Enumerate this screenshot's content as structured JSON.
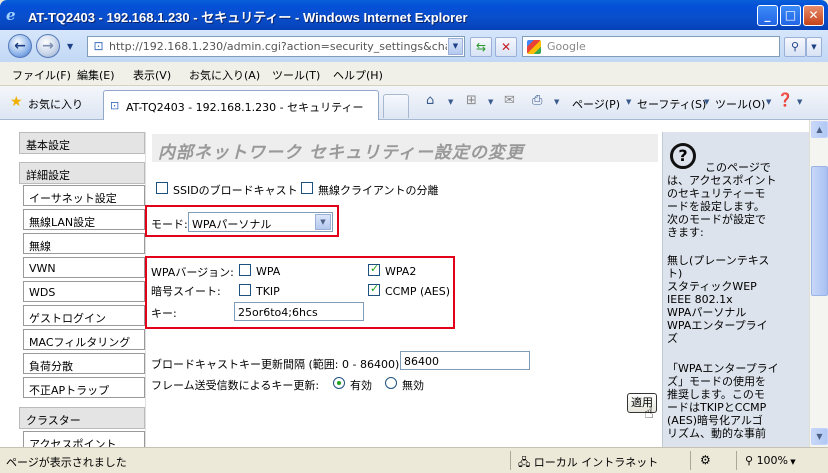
{
  "window": {
    "title": "AT-TQ2403 - 192.168.1.230 - セキュリティー - Windows Internet Explorer",
    "minimize_glyph": "_",
    "maximize_glyph": "□",
    "close_glyph": "✕"
  },
  "navbar": {
    "url": "http://192.168.1.230/admin.cgi?action=security_settings&change_r",
    "search_placeholder": "Google"
  },
  "menu": [
    "ファイル(F)",
    "編集(E)",
    "表示(V)",
    "お気に入り(A)",
    "ツール(T)",
    "ヘルプ(H)"
  ],
  "favbar": {
    "favorites_label": "お気に入り",
    "tab_title": "AT-TQ2403 - 192.168.1.230 - セキュリティー",
    "page_menu": "ページ(P)",
    "safety_menu": "セーフティ(S)",
    "tools_menu": "ツール(O)"
  },
  "leftnav": {
    "basic": "基本設定",
    "detail": "詳細設定",
    "items": [
      "イーサネット設定",
      "無線LAN設定",
      "無線",
      "VWN",
      "WDS",
      "ゲストログイン",
      "MACフィルタリング",
      "負荷分散",
      "不正APトラップ"
    ],
    "cluster": "クラスター",
    "cluster_item": "アクセスポイント"
  },
  "content": {
    "title": "内部ネットワーク セキュリティー設定の変更",
    "ssid_broadcast": "SSIDのブロードキャスト",
    "wireless_isolation": "無線クライアントの分離",
    "mode_label": "モード:",
    "mode_value": "WPAパーソナル",
    "wpa_version_label": "WPAバージョン:",
    "wpa": "WPA",
    "wpa2": "WPA2",
    "cipher_label": "暗号スイート:",
    "tkip": "TKIP",
    "ccmp": "CCMP (AES)",
    "key_label": "キー:",
    "key_value": "25or6to4;6hcs",
    "broadcast_key_label": "ブロードキャストキー更新間隔 (範囲: 0 - 86400):",
    "broadcast_key_value": "86400",
    "frame_rekey_label": "フレーム送受信数によるキー更新:",
    "enabled": "有効",
    "disabled": "無効",
    "apply": "適用"
  },
  "help": {
    "p1": "このページで",
    "p2": "は、アクセスポイント\nのセキュリティーモ\nードを設定します。\n次のモードが設定で\nきます:",
    "p3": "無し(プレーンテキス\nト)\nスタティックWEP\nIEEE 802.1x\nWPAパーソナル\nWPAエンタープライ\nズ",
    "p4": "「WPAエンタープライ\nズ」モードの使用を\n推奨します。このモ\nードはTKIPとCCMP\n(AES)暗号化アルゴ\nリズム、動的な事前"
  },
  "status": {
    "message": "ページが表示されました",
    "zone": "ローカル イントラネット",
    "zoom": "100%"
  }
}
